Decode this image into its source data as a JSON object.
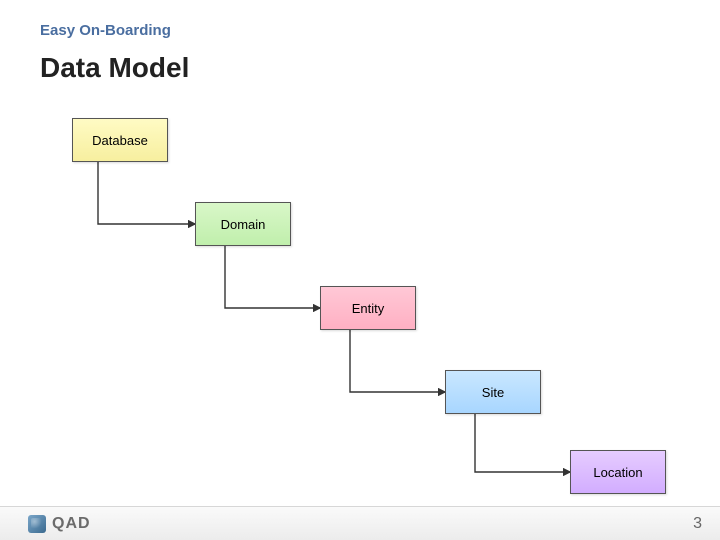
{
  "header": {
    "subtitle": "Easy On-Boarding",
    "title": "Data Model"
  },
  "boxes": {
    "database": "Database",
    "domain": "Domain",
    "entity": "Entity",
    "site": "Site",
    "location": "Location"
  },
  "footer": {
    "logo_text": "QAD",
    "page_number": "3"
  }
}
